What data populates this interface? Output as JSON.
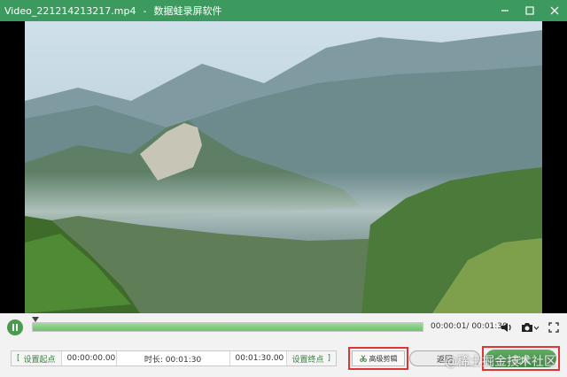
{
  "window": {
    "file_name": "Video_221214213217.mp4",
    "app_name": "数据蛙录屏软件"
  },
  "player": {
    "progress_fraction": 1.0,
    "current_time": "00:00:01",
    "total_time": "00:01:30"
  },
  "controls": {
    "set_start_label": "设置起点",
    "start_value": "00:00:00.00",
    "duration_label": "时长: 00:01:30",
    "end_value": "00:01:30.00",
    "set_end_label": "设置终点",
    "advanced_clip_label": "高级剪辑",
    "back_label": "返回",
    "finish_label": "完成"
  },
  "watermark": "@稀土掘金技术社区",
  "colors": {
    "titlebar": "#3c9a5f",
    "accent": "#4a9a4f",
    "highlight_box": "#e03535"
  }
}
